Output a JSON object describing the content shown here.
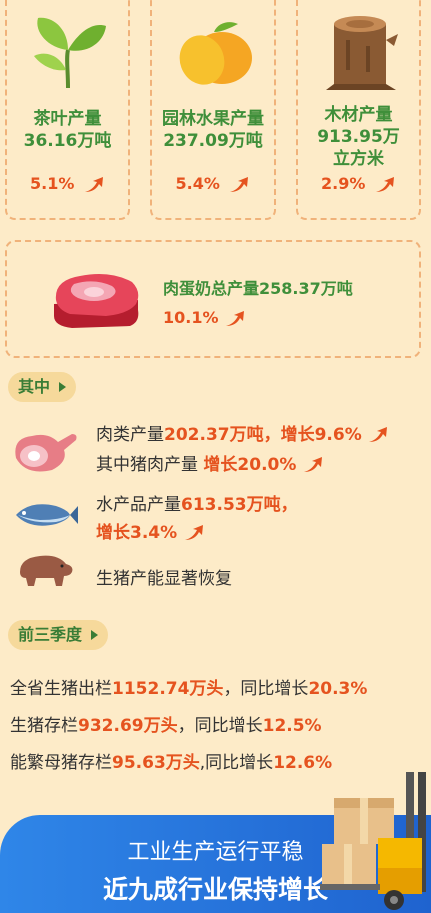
{
  "cards": [
    {
      "label": "茶叶产量\n36.16万吨",
      "percent": "5.1%"
    },
    {
      "label": "园林水果产量\n237.09万吨",
      "percent": "5.4%"
    },
    {
      "label": "木材产量\n913.95万\n立方米",
      "percent": "2.9%"
    }
  ],
  "meat_card": {
    "label": "肉蛋奶总产量258.37万吨",
    "percent": "10.1%"
  },
  "section_qizhong": {
    "title": "其中"
  },
  "items": {
    "meat_line1_prefix": "肉类产量",
    "meat_line1_value": "202.37万吨，增长9.6%",
    "pork_prefix": "其中猪肉产量",
    "pork_value": "增长20.0%",
    "aquatic_prefix": "水产品产量",
    "aquatic_value": "613.53万吨，",
    "aquatic_growth": "增长3.4%",
    "hog_capacity": "生猪产能显著恢复"
  },
  "section_q3": {
    "title": "前三季度"
  },
  "q3_lines": [
    {
      "pre": "全省生猪出栏",
      "val": "1152.74万头",
      "mid": "，同比增长",
      "val2": "20.3%"
    },
    {
      "pre": "生猪存栏",
      "val": "932.69万头",
      "mid": "，同比增长",
      "val2": "12.5%"
    },
    {
      "pre": "能繁母猪存栏",
      "val": "95.63万头",
      "mid": ",同比增长",
      "val2": "12.6%"
    }
  ],
  "banner": {
    "line1": "工业生产运行平稳",
    "line2": "近九成行业保持增长"
  },
  "colors": {
    "bg": "#fdebc8",
    "green": "#3f8f3a",
    "red": "#e5531f",
    "blue": "#2f86e8"
  }
}
